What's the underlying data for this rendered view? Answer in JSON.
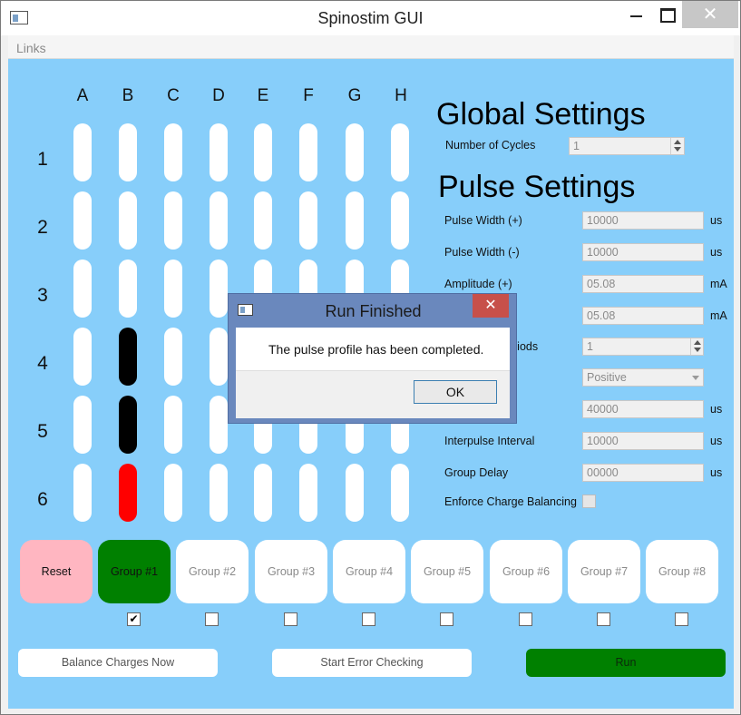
{
  "window": {
    "title": "Spinostim GUI",
    "close_glyph": "✕"
  },
  "menu": {
    "links": "Links"
  },
  "grid": {
    "columns": [
      "A",
      "B",
      "C",
      "D",
      "E",
      "F",
      "G",
      "H"
    ],
    "rows": [
      "1",
      "2",
      "3",
      "4",
      "5",
      "6"
    ],
    "active_color": "#000000",
    "highlight_color": "#ff0000",
    "electrode_states": {
      "B4": "active",
      "B5": "active",
      "B6": "highlight"
    }
  },
  "global_settings": {
    "title": "Global Settings",
    "cycles_label": "Number of Cycles",
    "cycles_value": "1"
  },
  "pulse_settings": {
    "title": "Pulse Settings",
    "pw_pos_label": "Pulse Width (+)",
    "pw_pos_value": "10000",
    "pw_pos_unit": "us",
    "pw_neg_label": "Pulse Width (-)",
    "pw_neg_value": "10000",
    "pw_neg_unit": "us",
    "amp_pos_label": "Amplitude (+)",
    "amp_pos_value": "05.08",
    "amp_pos_unit": "mA",
    "amp_neg_value": "05.08",
    "amp_neg_unit": "mA",
    "periods_label_partial": "riods",
    "periods_value": "1",
    "polarity_value": "Positive",
    "period_value": "40000",
    "period_unit": "us",
    "interpulse_label": "Interpulse Interval",
    "interpulse_value": "10000",
    "interpulse_unit": "us",
    "group_delay_label": "Group Delay",
    "group_delay_value": "00000",
    "group_delay_unit": "us",
    "charge_balancing_label": "Enforce Charge Balancing",
    "charge_balancing_checked": false
  },
  "groups": {
    "reset_label": "Reset",
    "active_group": 1,
    "items": [
      {
        "label": "Group #1",
        "checked": true,
        "check_glyph": "✔"
      },
      {
        "label": "Group #2",
        "checked": false,
        "check_glyph": ""
      },
      {
        "label": "Group #3",
        "checked": false,
        "check_glyph": ""
      },
      {
        "label": "Group #4",
        "checked": false,
        "check_glyph": ""
      },
      {
        "label": "Group #5",
        "checked": false,
        "check_glyph": ""
      },
      {
        "label": "Group #6",
        "checked": false,
        "check_glyph": ""
      },
      {
        "label": "Group #7",
        "checked": false,
        "check_glyph": ""
      },
      {
        "label": "Group #8",
        "checked": false,
        "check_glyph": ""
      }
    ]
  },
  "actions": {
    "balance_label": "Balance Charges Now",
    "error_check_label": "Start Error Checking",
    "run_label": "Run"
  },
  "dialog": {
    "title": "Run Finished",
    "close_glyph": "✕",
    "message": "The pulse profile has been completed.",
    "ok_label": "OK"
  },
  "colors": {
    "background": "#87cefa",
    "reset": "#ffb6c1",
    "active_group": "#008000",
    "run": "#008000",
    "dialog_frame": "#6a88bd",
    "dialog_close": "#c7504a"
  }
}
